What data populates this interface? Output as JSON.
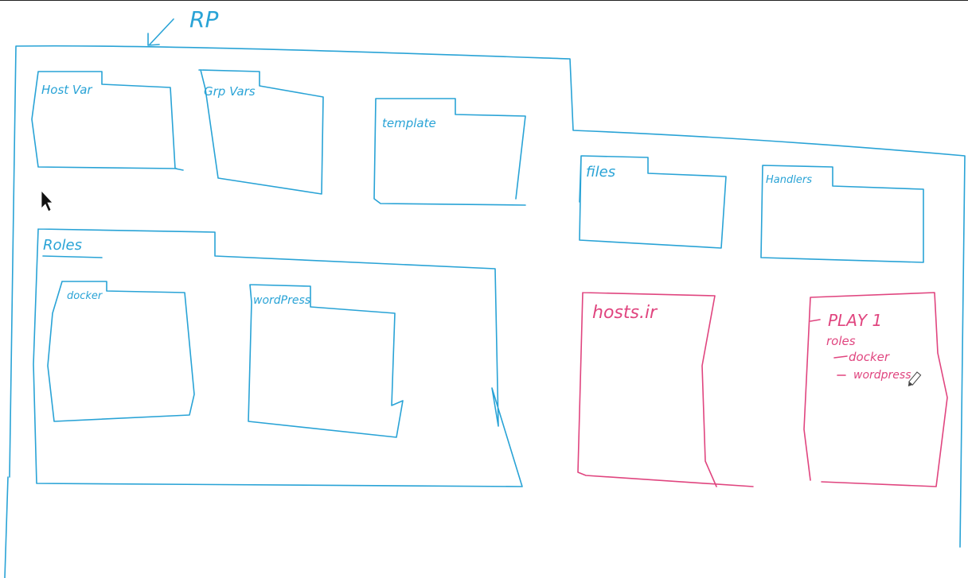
{
  "colors": {
    "ink_blue": "#29a3d6",
    "ink_pink": "#e0457f",
    "background": "#ffffff"
  },
  "labels": {
    "rp": "RP",
    "host_var": "Host Var",
    "grp_vars": "Grp Vars",
    "template": "template",
    "files": "files",
    "handlers": "Handlers",
    "roles": "Roles",
    "docker": "docker",
    "wordpress": "wordPress",
    "hosts": "hosts.ir"
  },
  "play_note": {
    "title": "PLAY 1",
    "roles": "roles",
    "items": [
      "docker",
      "wordpress"
    ]
  },
  "icons": {
    "cursor": "mouse-pointer-icon",
    "pencil": "pencil-icon"
  }
}
